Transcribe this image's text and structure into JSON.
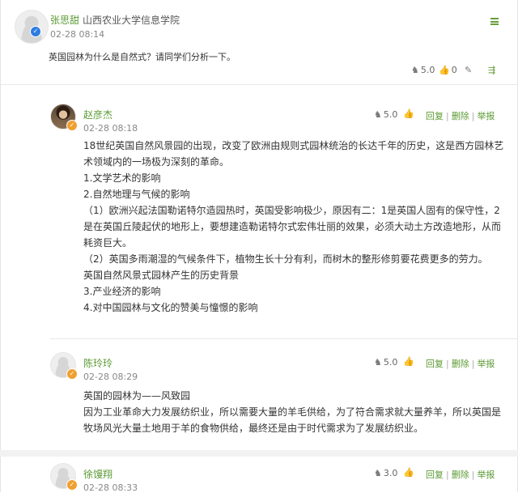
{
  "post": {
    "author": "张思甜",
    "school": "山西农业大学信息学院",
    "time": "02-28 08:14",
    "content": "英国园林为什么是自然式？请同学们分析一下。",
    "score": "5.0",
    "likes": "0"
  },
  "actions": {
    "reply": "回复",
    "delete": "删除",
    "report": "举报",
    "sep": "|"
  },
  "replies": [
    {
      "author": "赵彦杰",
      "time": "02-28 08:18",
      "score": "5.0",
      "lines": [
        "18世纪英国自然风景园的出现，改变了欧洲由规则式园林统治的长达千年的历史，这是西方园林艺",
        "术领域内的一场极为深刻的革命。",
        "1.文学艺术的影响",
        "2.自然地理与气候的影响",
        "（1）欧洲兴起法国勒诺特尔造园热时，英国受影响极少，原因有二：1是英国人固有的保守性，2",
        "是在英国丘陵起伏的地形上，要想建造勒诺特尔式宏伟壮丽的效果，必须大动土方改造地形，从而",
        "耗资巨大。",
        "（2）英国多雨潮湿的气候条件下，植物生长十分有利，而树木的整形修剪要花费更多的劳力。",
        "英国自然风景式园林产生的历史背景",
        "3.产业经济的影响",
        "4.对中国园林与文化的赞美与憧憬的影响"
      ]
    },
    {
      "author": "陈玲玲",
      "time": "02-28 08:29",
      "score": "5.0",
      "lines": [
        "英国的园林为——风致园",
        "因为工业革命大力发展纺织业，所以需要大量的羊毛供给，为了符合需求就大量养羊，所以英国是",
        "牧场风光大量土地用于羊的食物供给，最终还是由于时代需求为了发展纺织业。"
      ]
    },
    {
      "author": "徐馒翔",
      "time": "02-28 08:33",
      "score": "3.0",
      "lines": []
    }
  ],
  "colors": {
    "accent": "#5a9a32",
    "text": "#333333",
    "muted": "#888888"
  }
}
